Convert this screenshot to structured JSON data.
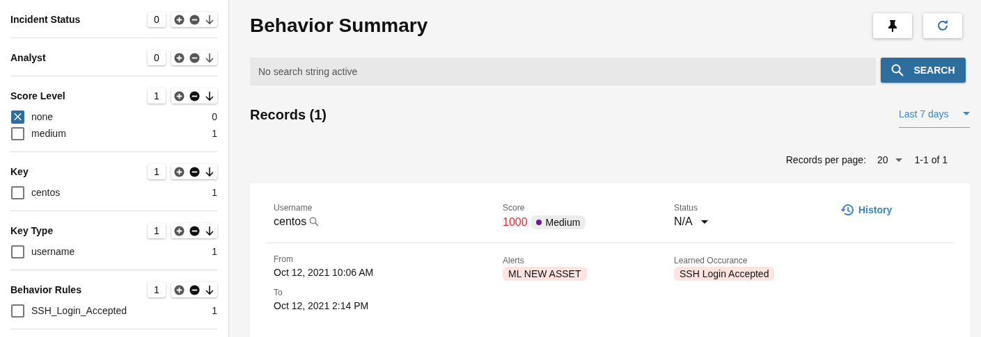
{
  "filters": [
    {
      "title": "Incident Status",
      "count": "0",
      "exclude": false
    },
    {
      "title": "Analyst",
      "count": "0",
      "exclude": false
    },
    {
      "title": "Score Level",
      "count": "1",
      "exclude": true,
      "items": [
        {
          "label": "none",
          "count": "0",
          "checked": true
        },
        {
          "label": "medium",
          "count": "1",
          "checked": false
        }
      ]
    },
    {
      "title": "Key",
      "count": "1",
      "exclude": true,
      "items": [
        {
          "label": "centos",
          "count": "1",
          "checked": false
        }
      ]
    },
    {
      "title": "Key Type",
      "count": "1",
      "exclude": true,
      "items": [
        {
          "label": "username",
          "count": "1",
          "checked": false
        }
      ]
    },
    {
      "title": "Behavior Rules",
      "count": "1",
      "exclude": true,
      "items": [
        {
          "label": "SSH_Login_Accepted",
          "count": "1",
          "checked": false
        }
      ]
    }
  ],
  "main": {
    "title": "Behavior Summary",
    "search": {
      "placeholder": "No search string active",
      "button": "SEARCH"
    },
    "records_heading": "Records (1)",
    "time_range": "Last 7 days",
    "pagination": {
      "label": "Records per page:",
      "per_page": "20",
      "range": "1-1 of 1"
    },
    "record": {
      "username_label": "Username",
      "username": "centos",
      "score_label": "Score",
      "score": "1000",
      "score_level": "Medium",
      "status_label": "Status",
      "status": "N/A",
      "history": "History",
      "from_label": "From",
      "from": "Oct 12, 2021 10:06 AM",
      "to_label": "To",
      "to": "Oct 12, 2021 2:14 PM",
      "alerts_label": "Alerts",
      "alerts": [
        "ML NEW ASSET"
      ],
      "learned_label": "Learned Occurance",
      "learned": [
        "SSH Login Accepted"
      ]
    }
  }
}
